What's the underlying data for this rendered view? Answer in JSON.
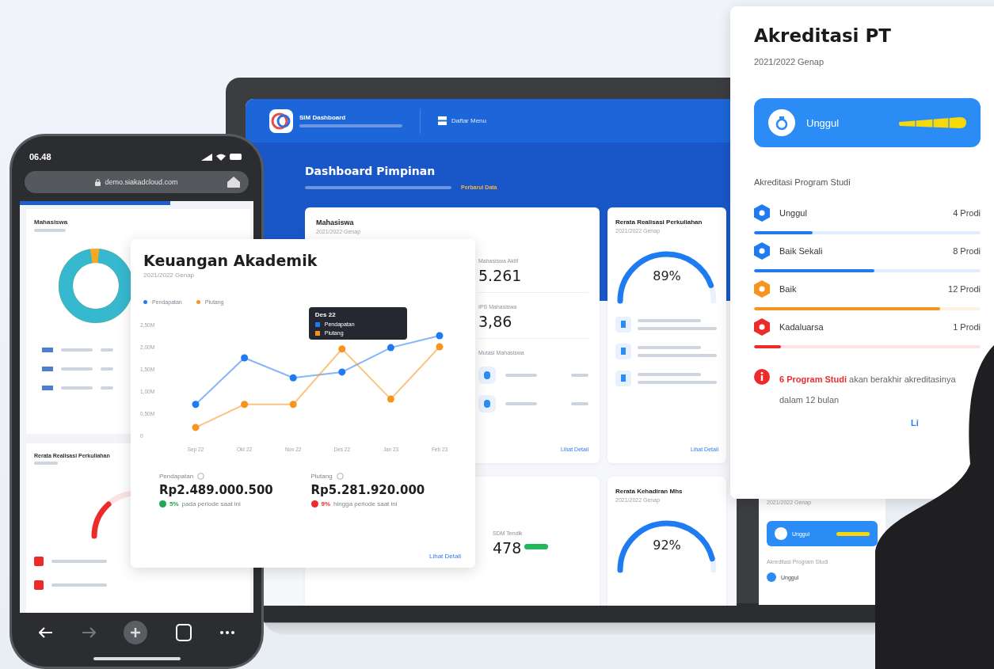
{
  "laptop": {
    "app_name": "SIM Dashboard",
    "menu_label": "Daftar Menu",
    "page_title": "Dashboard Pimpinan",
    "refresh_link": "Perbarui Data",
    "students_card": {
      "title": "Mahasiswa",
      "period": "2021/2022 Genap",
      "stats": [
        {
          "label": "Mahasiswa Aktif",
          "value": "5.261"
        },
        {
          "label": "IPS Mahasiswa",
          "value": "3,86"
        }
      ],
      "mutation_title": "Mutasi Mahasiswa",
      "link": "Lihat Detail"
    },
    "lecture_card": {
      "title": "Rerata Realisasi Perkuliahan",
      "period": "2021/2022 Genap",
      "gauge": {
        "reading": "89%",
        "level": 0.89
      },
      "link": "Lihat Detail"
    },
    "staff_card": {
      "label": "SDM Tendik",
      "value": "478"
    },
    "attendance_card": {
      "title": "Rerata Kehadiran Mhs",
      "period": "2021/2022 Genap",
      "gauge": {
        "reading": "92%",
        "level": 0.92
      }
    },
    "accreditation_preview": {
      "period": "2021/2022 Genap",
      "badge": "Unggul",
      "section": "Akreditasi Program Studi",
      "first_item": "Unggul"
    }
  },
  "phone": {
    "time": "06.48",
    "url": "demo.siakadcloud.com",
    "card_title": "Mahasiswa",
    "donut": {
      "level": 0.96
    },
    "second_card_title": "Rerata Realisasi Perkuliahan"
  },
  "finance_card": {
    "title": "Keuangan Akademik",
    "period": "2021/2022 Genap",
    "chart_data": {
      "type": "line",
      "categories": [
        "Sep 22",
        "Okt 22",
        "Nov 22",
        "Des 22",
        "Jan 23",
        "Feb 23"
      ],
      "series": [
        {
          "name": "Pendapatan",
          "color": "#1e7bf2",
          "marker": "circle",
          "values": [
            0.7,
            1.75,
            1.3,
            1.43,
            1.98,
            2.25
          ]
        },
        {
          "name": "Piutang",
          "color": "#f7941d",
          "marker": "circle",
          "values": [
            0.18,
            0.7,
            0.7,
            1.95,
            0.82,
            2.0
          ]
        }
      ],
      "ylim": [
        0,
        2.5
      ],
      "yticks": [
        {
          "value": 0,
          "label": "0"
        },
        {
          "value": 0.5,
          "label": "0,50M"
        },
        {
          "value": 1,
          "label": "1,00M"
        },
        {
          "value": 1.5,
          "label": "1,50M"
        },
        {
          "value": 2,
          "label": "2,00M"
        },
        {
          "value": 2.5,
          "label": "2,50M"
        }
      ]
    },
    "tooltip": {
      "title": "Des 22"
    },
    "totals": [
      {
        "label": "Pendapatan",
        "value": "Rp2.489.000.500",
        "change": "5%",
        "color": "#22a64f",
        "note": "pada periode saat ini"
      },
      {
        "label": "Piutang",
        "value": "Rp5.281.920.000",
        "change": "9%",
        "color": "#ee2b2b",
        "note": "hingga periode saat ini"
      }
    ],
    "link": "Lihat Detail"
  },
  "accreditation_card": {
    "title": "Akreditasi PT",
    "period": "2021/2022 Genap",
    "badge": "Unggul",
    "section": "Akreditasi Program Studi",
    "items": [
      {
        "name": "Unggul",
        "count": "4 Prodi",
        "level": 0.26,
        "color": "#1e7bf2"
      },
      {
        "name": "Baik Sekali",
        "count": "8 Prodi",
        "level": 0.53,
        "color": "#1e7bf2"
      },
      {
        "name": "Baik",
        "count": "12 Prodi",
        "level": 0.82,
        "color": "#f7941d"
      },
      {
        "name": "Kadaluarsa",
        "count": "1 Prodi",
        "level": 0.12,
        "color": "#ee2b2b"
      }
    ],
    "warning": "**6 Program Studi** akan berakhir akreditasinya dalam 12 bulan",
    "link": "Li"
  }
}
